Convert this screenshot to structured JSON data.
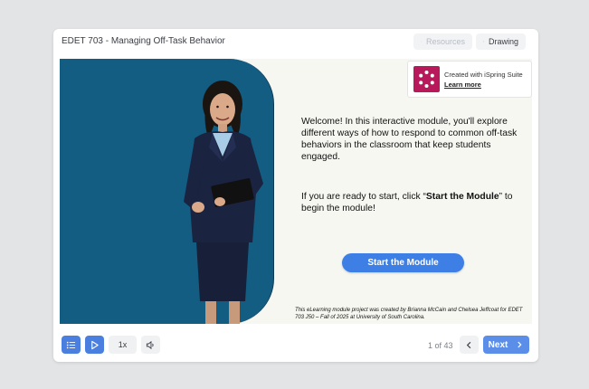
{
  "header": {
    "title": "EDET 703 - Managing Off-Task Behavior",
    "resources_label": "Resources",
    "drawing_label": "Drawing"
  },
  "slide": {
    "ispring": {
      "created_text": "Created with iSpring Suite",
      "learn_more": "Learn more"
    },
    "welcome_text": "Welcome! In this interactive module, you'll explore different ways of how to respond to common off-task behaviors in the classroom that keep students engaged.",
    "instruction_prefix": "If you are ready to start, click “",
    "instruction_bold": "Start the Module",
    "instruction_suffix": "” to begin the module!",
    "start_button": "Start the Module",
    "credits": "This eLearning module project was created by Brianna McCain and Chelsea Jeffcoat for EDET 703 J50 – Fall of 2025 at University of South Carolina."
  },
  "footer": {
    "speed_label": "1x",
    "page_counter": "1 of 43",
    "next_label": "Next"
  },
  "colors": {
    "accent": "#3e7fe6",
    "slide_blue": "#135c82",
    "ispring_brand": "#b7195a"
  }
}
